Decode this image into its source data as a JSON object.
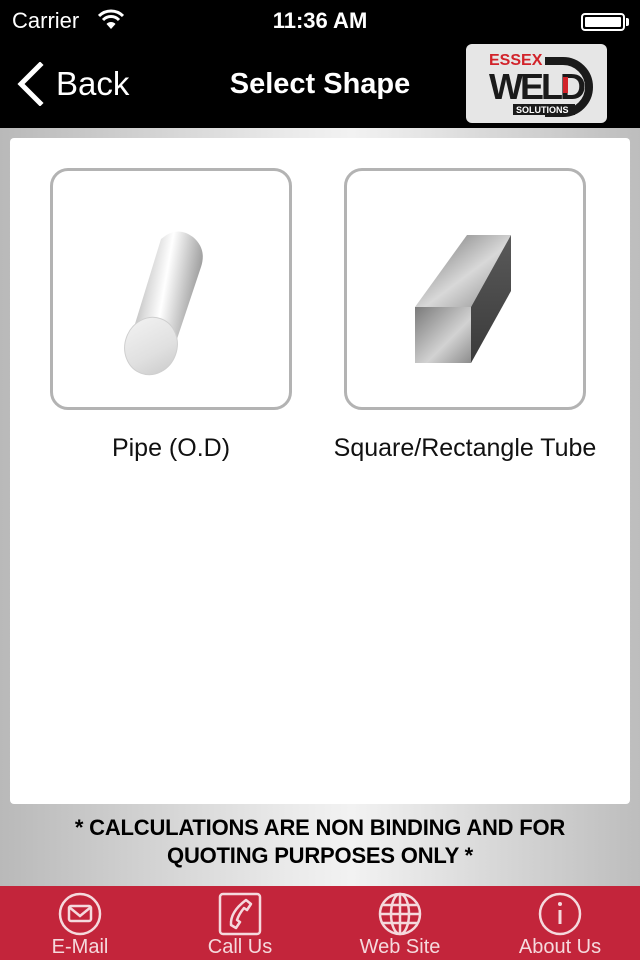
{
  "status_bar": {
    "carrier": "Carrier",
    "time": "11:36 AM",
    "battery_level": 1.0
  },
  "nav": {
    "back_label": "Back",
    "title": "Select Shape",
    "logo": {
      "top_text": "ESSEX",
      "main_text": "WELD",
      "sub_text": "SOLUTIONS"
    }
  },
  "shapes": [
    {
      "label": "Pipe (O.D)",
      "icon": "cylinder-icon"
    },
    {
      "label": "Square/Rectangle Tube",
      "icon": "square-bar-icon"
    }
  ],
  "disclaimer": {
    "line1": "* CALCULATIONS ARE NON BINDING AND FOR",
    "line2": "QUOTING PURPOSES ONLY *"
  },
  "tabs": [
    {
      "label": "E-Mail",
      "icon": "envelope-icon"
    },
    {
      "label": "Call Us",
      "icon": "phone-icon"
    },
    {
      "label": "Web Site",
      "icon": "globe-icon"
    },
    {
      "label": "About Us",
      "icon": "info-icon"
    }
  ],
  "colors": {
    "header": "#000000",
    "tabbar": "#c3253b",
    "logo_red": "#d2232a"
  }
}
